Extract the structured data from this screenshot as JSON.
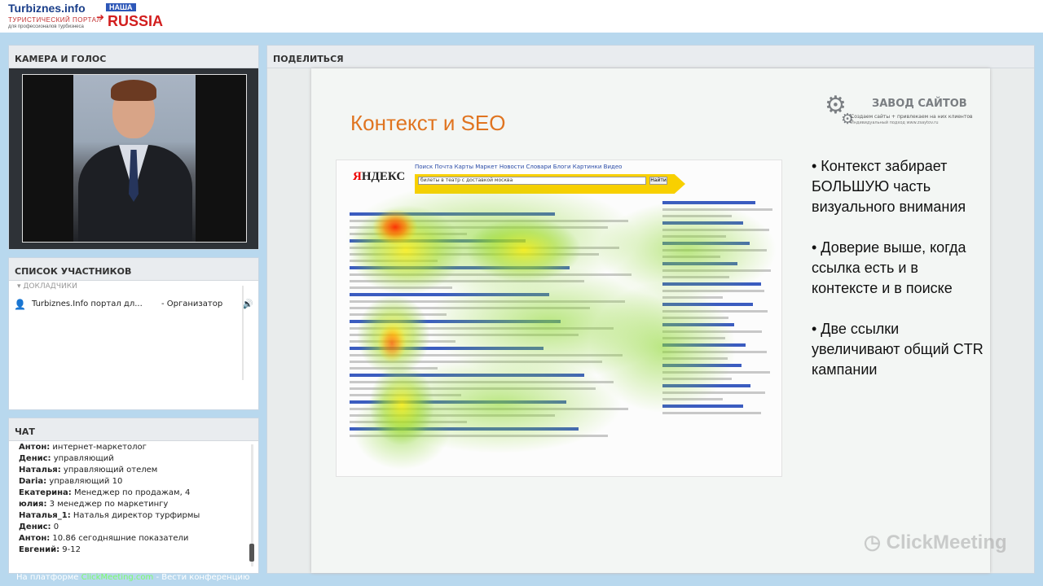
{
  "brand": {
    "site_name": "Turbiznes.info",
    "tagline": "ТУРИСТИЧЕСКИЙ ПОРТАЛ",
    "sub_tagline": "для профессионалов турбизнеса",
    "partner_top": "НАША",
    "partner_main": "RUSSIA"
  },
  "camera": {
    "title": "КАМЕРА И ГОЛОС"
  },
  "participants": {
    "title": "СПИСОК УЧАСТНИКОВ",
    "group_label": "▾  ДОКЛАДЧИКИ",
    "items": [
      {
        "name": "Turbiznes.Info портал дл...",
        "role": "- Организатор"
      }
    ]
  },
  "chat": {
    "title": "ЧАТ",
    "messages": [
      {
        "author": "Антон:",
        "text": "интернет-маркетолог"
      },
      {
        "author": "Денис:",
        "text": "управляющий"
      },
      {
        "author": "Наталья:",
        "text": "управляющий отелем"
      },
      {
        "author": "Daria:",
        "text": "управляющий 10"
      },
      {
        "author": "Екатерина:",
        "text": "Менеджер по продажам, 4"
      },
      {
        "author": "юлия:",
        "text": "3 менеджер по маркетингу"
      },
      {
        "author": "Наталья_1:",
        "text": "Наталья директор турфирмы"
      },
      {
        "author": "Денис:",
        "text": "0"
      },
      {
        "author": "Антон:",
        "text": "10.86 сегодняшние показатели"
      },
      {
        "author": "Евгений:",
        "text": "9-12"
      }
    ]
  },
  "share": {
    "title": "ПОДЕЛИТЬСЯ",
    "slide_title": "Контекст и SEO",
    "company_name": "ЗАВОД САЙТОВ",
    "company_tag": "Создаем сайты + привлекаем на них клиентов",
    "company_tag2": "Индивидуальный подход  www.zsaytov.ru",
    "serp_logo_first": "Я",
    "serp_logo_rest": "НДЕКС",
    "serp_nav": "Поиск  Почта  Карты  Маркет  Новости  Словари  Блоги  Картинки  Видео",
    "serp_query": "билеты в театр с доставкой москва",
    "serp_button": "Найти",
    "bullets": [
      "• Контекст забирает БОЛЬШУЮ часть визуального внимания",
      "• Доверие выше, когда ссылка есть и в контексте и в поиске",
      "• Две ссылки увеличивают общий CTR кампании"
    ],
    "watermark": "ClickMeeting"
  },
  "footer": {
    "prefix": "На платформе ",
    "link": "ClickMeeting.com",
    "suffix": " - Вести конференцию"
  },
  "colors": {
    "accent_orange": "#e07420",
    "panel_bg": "#ffffff",
    "page_bg": "#b8d8ee",
    "footer_link": "#7cfc6c"
  }
}
